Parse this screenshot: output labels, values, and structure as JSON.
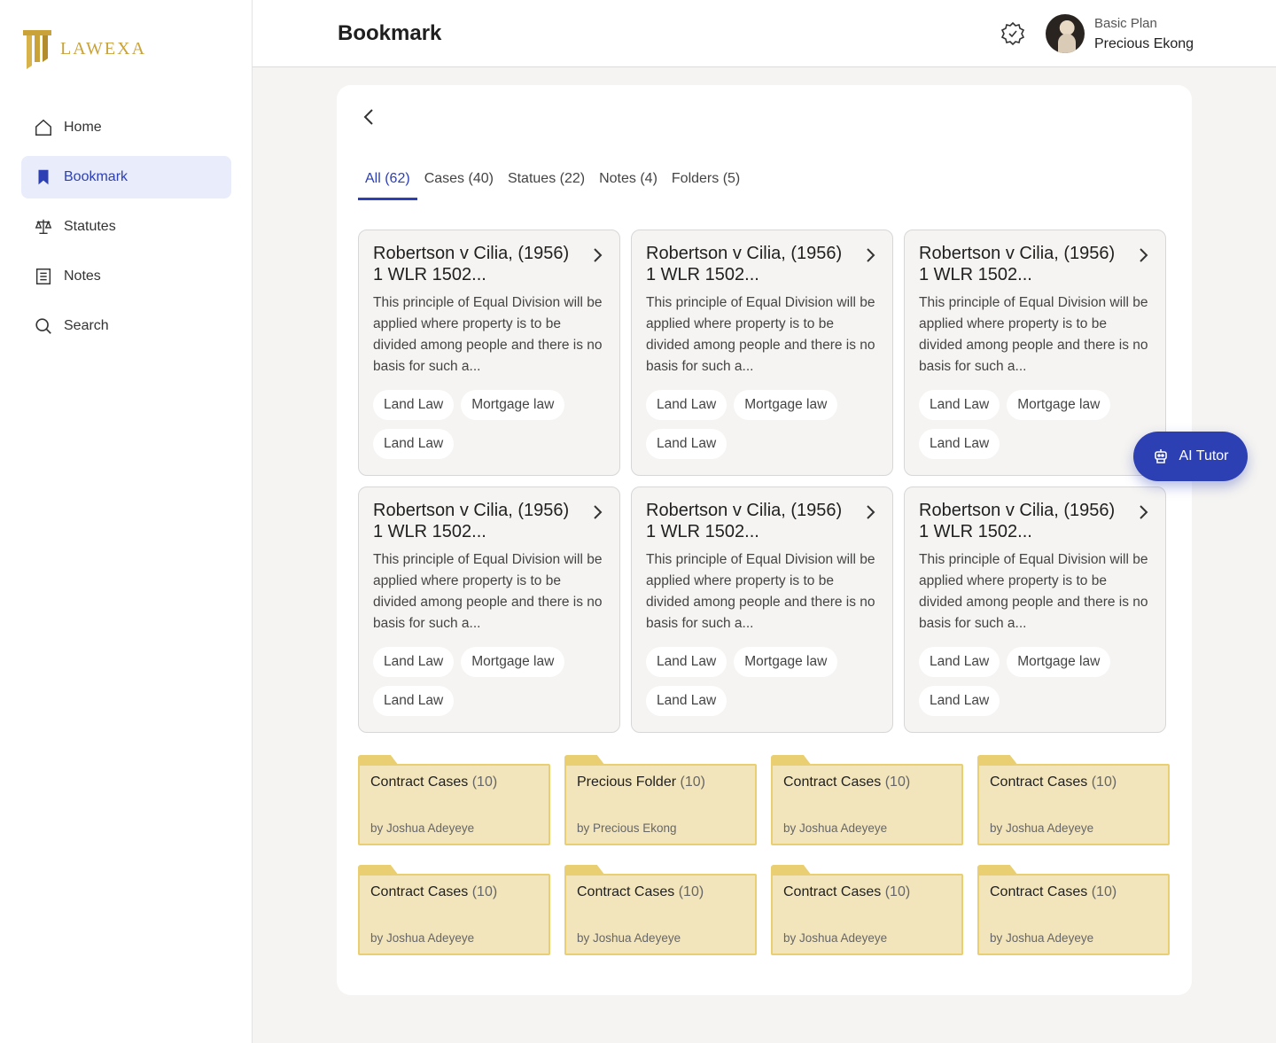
{
  "brand": {
    "name": "LAWEXA",
    "accent": "#2c3fb3",
    "gold": "#c9a23a"
  },
  "sidebar": {
    "items": [
      {
        "label": "Home",
        "icon": "home-icon",
        "active": false
      },
      {
        "label": "Bookmark",
        "icon": "bookmark-icon",
        "active": true
      },
      {
        "label": "Statutes",
        "icon": "scales-icon",
        "active": false
      },
      {
        "label": "Notes",
        "icon": "notes-icon",
        "active": false
      },
      {
        "label": "Search",
        "icon": "search-icon",
        "active": false
      }
    ]
  },
  "header": {
    "title": "Bookmark",
    "user_plan": "Basic Plan",
    "user_name": "Precious Ekong"
  },
  "tabs": [
    {
      "label": "All (62)",
      "active": true
    },
    {
      "label": "Cases (40)",
      "active": false
    },
    {
      "label": "Statues (22)",
      "active": false
    },
    {
      "label": "Notes (4)",
      "active": false
    },
    {
      "label": "Folders (5)",
      "active": false
    }
  ],
  "cards": [
    {
      "title": "Robertson v Cilia, (1956) 1 WLR 1502...",
      "desc": "This principle of Equal Division will be applied where property is to be divided among people and there is no basis for such a...",
      "tags": [
        "Land Law",
        "Mortgage law",
        "Land Law"
      ]
    },
    {
      "title": "Robertson v Cilia, (1956) 1 WLR 1502...",
      "desc": "This principle of Equal Division will be applied where property is to be divided among people and there is no basis for such a...",
      "tags": [
        "Land Law",
        "Mortgage law",
        "Land Law"
      ]
    },
    {
      "title": "Robertson v Cilia, (1956) 1 WLR 1502...",
      "desc": "This principle of Equal Division will be applied where property is to be divided among people and there is no basis for such a...",
      "tags": [
        "Land Law",
        "Mortgage law",
        "Land Law"
      ]
    },
    {
      "title": "Robertson v Cilia, (1956) 1 WLR 1502...",
      "desc": "This principle of Equal Division will be applied where property is to be divided among people and there is no basis for such a...",
      "tags": [
        "Land Law",
        "Mortgage law",
        "Land Law"
      ]
    },
    {
      "title": "Robertson v Cilia, (1956) 1 WLR 1502...",
      "desc": "This principle of Equal Division will be applied where property is to be divided among people and there is no basis for such a...",
      "tags": [
        "Land Law",
        "Mortgage law",
        "Land Law"
      ]
    },
    {
      "title": "Robertson v Cilia, (1956) 1 WLR 1502...",
      "desc": "This principle of Equal Division will be applied where property is to be divided among people and there is no basis for such a...",
      "tags": [
        "Land Law",
        "Mortgage law",
        "Land Law"
      ]
    }
  ],
  "folders": [
    {
      "name": "Contract Cases",
      "count": "(10)",
      "by": "by Joshua Adeyeye"
    },
    {
      "name": "Precious Folder",
      "count": "(10)",
      "by": "by Precious Ekong"
    },
    {
      "name": "Contract Cases",
      "count": "(10)",
      "by": "by Joshua Adeyeye"
    },
    {
      "name": "Contract Cases",
      "count": "(10)",
      "by": "by Joshua Adeyeye"
    },
    {
      "name": "Contract Cases",
      "count": "(10)",
      "by": "by Joshua Adeyeye"
    },
    {
      "name": "Contract Cases",
      "count": "(10)",
      "by": "by Joshua Adeyeye"
    },
    {
      "name": "Contract Cases",
      "count": "(10)",
      "by": "by Joshua Adeyeye"
    },
    {
      "name": "Contract Cases",
      "count": "(10)",
      "by": "by Joshua Adeyeye"
    }
  ],
  "ai_tutor": {
    "label": "AI Tutor",
    "icon": "robot-icon"
  }
}
